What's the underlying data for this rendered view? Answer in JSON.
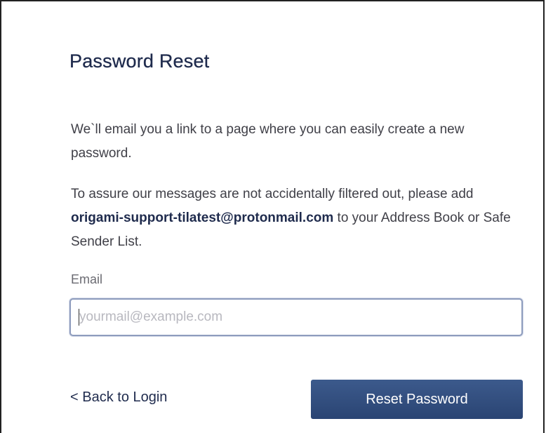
{
  "form": {
    "title": "Password Reset",
    "intro_text": "We`ll email you a link to a page where you can easily create a new password.",
    "notice_prefix": "To assure our messages are not accidentally filtered out, please add ",
    "notice_email": "origami-support-tilatest@protonmail.com",
    "notice_suffix": " to your Address Book or Safe Sender List.",
    "email_label": "Email",
    "email_value": "",
    "email_placeholder": "yourmail@example.com",
    "back_link_label": "< Back to Login",
    "submit_label": "Reset Password"
  },
  "colors": {
    "title": "#1f2b4d",
    "button_bg": "#2f4a7b",
    "input_border": "#8e9cbd"
  }
}
